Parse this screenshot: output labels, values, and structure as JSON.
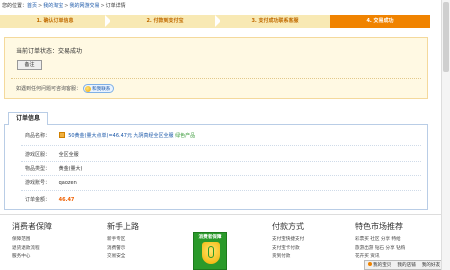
{
  "breadcrumb": {
    "prefix": "您的位置：",
    "items": [
      "首页",
      "我的淘宝",
      "我的网游交易",
      "订单详情"
    ],
    "separator": ">"
  },
  "steps": [
    {
      "label": "1. 确认订单信息",
      "state": "done"
    },
    {
      "label": "2. 付款到支付宝",
      "state": "done"
    },
    {
      "label": "3. 支付成功联系客服",
      "state": "done"
    },
    {
      "label": "4. 交易成功",
      "state": "current"
    }
  ],
  "status": {
    "label": "当前订单状态：",
    "value": "交易成功",
    "note_button": "备注",
    "contact_text": "如遇到任何问题可咨询客服：",
    "chat_button": "和我联系"
  },
  "order": {
    "tab": "订单信息",
    "product_label": "商品名称：",
    "product_name": "50黄金(量大点单)=46.47元 九阴真经全区全服",
    "product_tag": "绿色产品",
    "server_label": "游戏区服：",
    "server_value": "全区全服",
    "item_label": "物品类型：",
    "item_value": "黄金(量大)",
    "account_label": "游戏账号：",
    "account_value": "qaozen",
    "amount_label": "订单金额：",
    "amount_value": "46.47"
  },
  "footer": {
    "columns": [
      {
        "title": "消费者保障",
        "links": [
          "保障范围",
          "退货退款流程",
          "服务中心",
          "更多特色服务"
        ]
      },
      {
        "title": "新手上路",
        "links": [
          "新手专区",
          "消费警示",
          "交易安全",
          "24小时在线帮助"
        ]
      },
      {
        "title": "付款方式",
        "links": [
          "支付宝快捷支付",
          "支付宝卡付款",
          "货到付款",
          "支付宝余额"
        ]
      },
      {
        "title": "特色市场推荐",
        "links": [
          "彩票买   社区 分享 特给",
          "旅游出游  钻石 分享 钻购",
          "花卉买  资讯",
          "全球购"
        ]
      }
    ],
    "badge_title": "消费者保障"
  },
  "float_bar": {
    "items": [
      "我的宝贝",
      "我的店铺",
      "我的好友"
    ]
  },
  "colors": {
    "accent": "#f08300",
    "step_done_bg": "#f8e9b4",
    "link": "#1a57a8",
    "price": "#f06000"
  }
}
